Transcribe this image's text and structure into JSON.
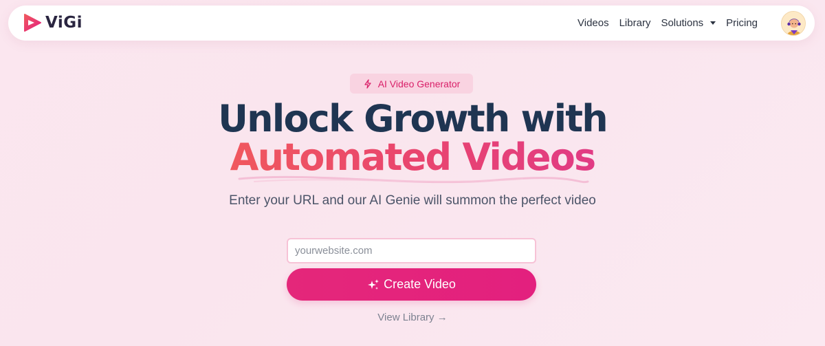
{
  "brand": {
    "name": "ViGi"
  },
  "nav": {
    "items": [
      {
        "label": "Videos"
      },
      {
        "label": "Library"
      },
      {
        "label": "Solutions"
      },
      {
        "label": "Pricing"
      }
    ]
  },
  "hero": {
    "badge": "AI Video Generator",
    "headline_line1": "Unlock Growth with",
    "headline_line2": "Automated Videos",
    "subtitle": "Enter your URL and our AI Genie will summon the perfect video"
  },
  "form": {
    "url_placeholder": "yourwebsite.com",
    "url_value": "",
    "submit_label": "Create Video"
  },
  "secondary_link": "View Library →",
  "icons": {
    "logo": "play-triangle-icon",
    "badge": "lightning-bolt-icon",
    "button": "sparkles-icon",
    "dropdown": "caret-down-icon"
  },
  "colors": {
    "primary": "#e3207e",
    "heading": "#1f3552",
    "accent_gradient_start": "#f0585e",
    "accent_gradient_end": "#e13b84",
    "badge_bg": "#f9d3e1"
  }
}
